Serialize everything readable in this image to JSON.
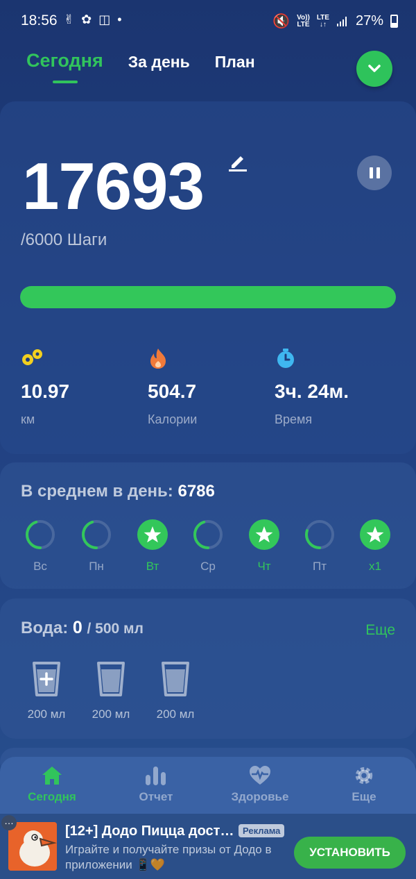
{
  "status_bar": {
    "time": "18:56",
    "battery": "27%",
    "network_top": "Vo))",
    "network_bottom": "LTE",
    "lte_top": "LTE",
    "lte_bottom": "↓↑"
  },
  "tabs": [
    {
      "label": "Сегодня",
      "active": true
    },
    {
      "label": "За день",
      "active": false
    },
    {
      "label": "План",
      "active": false
    }
  ],
  "today": {
    "steps": "17693",
    "goal_label": "/6000 Шаги",
    "progress_fraction": 1.0
  },
  "metrics": [
    {
      "value": "10.97",
      "label": "км",
      "icon": "footprints-icon"
    },
    {
      "value": "504.7",
      "label": "Калории",
      "icon": "flame-icon"
    },
    {
      "value": "3ч. 24м.",
      "label": "Время",
      "icon": "stopwatch-icon"
    }
  ],
  "average": {
    "label": "В среднем в день:",
    "value": "6786"
  },
  "week": [
    {
      "label": "Вс",
      "done": false,
      "progress": 0.45
    },
    {
      "label": "Пн",
      "done": false,
      "progress": 0.45
    },
    {
      "label": "Вт",
      "done": true,
      "progress": 1.0
    },
    {
      "label": "Ср",
      "done": false,
      "progress": 0.45
    },
    {
      "label": "Чт",
      "done": true,
      "progress": 1.0
    },
    {
      "label": "Пт",
      "done": false,
      "progress": 0.3
    },
    {
      "label": "x1",
      "done": true,
      "progress": 1.0
    }
  ],
  "water": {
    "label": "Вода:",
    "value": "0",
    "goal": "/ 500 мл",
    "more": "Еще",
    "cups": [
      {
        "label": "200 мл",
        "add": true
      },
      {
        "label": "200 мл",
        "add": false
      },
      {
        "label": "200 мл",
        "add": false
      }
    ]
  },
  "nav": [
    {
      "label": "Сегодня",
      "icon": "home-icon",
      "active": true
    },
    {
      "label": "Отчет",
      "icon": "bar-chart-icon",
      "active": false
    },
    {
      "label": "Здоровье",
      "icon": "heart-pulse-icon",
      "active": false
    },
    {
      "label": "Еще",
      "icon": "gear-icon",
      "active": false
    }
  ],
  "ad": {
    "title": "[12+] Додо Пицца дост…",
    "badge": "Реклама",
    "text": "Играйте и получайте призы от Додо в приложении",
    "cta": "УСТАНОВИТЬ"
  },
  "colors": {
    "accent": "#31c45c",
    "background": "#1b3570",
    "card": "#2d4f8f"
  }
}
